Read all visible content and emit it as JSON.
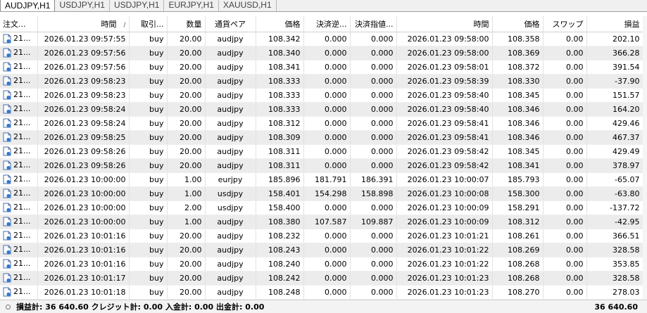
{
  "tabs": [
    {
      "label": "AUDJPY,H1",
      "active": true
    },
    {
      "label": "USDJPY,H1",
      "active": false
    },
    {
      "label": "USDJPY,H1",
      "active": false
    },
    {
      "label": "EURJPY,H1",
      "active": false
    },
    {
      "label": "XAUUSD,H1",
      "active": false
    }
  ],
  "columns": [
    "注文...",
    "時間",
    "取引...",
    "数量",
    "通貨ペア",
    "価格",
    "決済逆...",
    "決済指値...",
    "時間",
    "価格",
    "スワップ",
    "損益"
  ],
  "sort_mark": "/",
  "icon": "order-ticket-icon",
  "rows": [
    [
      "21...",
      "2026.01.23 09:57:55",
      "buy",
      "20.00",
      "audjpy",
      "108.342",
      "0.000",
      "0.000",
      "2026.01.23 09:58:00",
      "108.358",
      "0.00",
      "202.10"
    ],
    [
      "21...",
      "2026.01.23 09:57:56",
      "buy",
      "20.00",
      "audjpy",
      "108.340",
      "0.000",
      "0.000",
      "2026.01.23 09:58:00",
      "108.369",
      "0.00",
      "366.28"
    ],
    [
      "21...",
      "2026.01.23 09:57:56",
      "buy",
      "20.00",
      "audjpy",
      "108.341",
      "0.000",
      "0.000",
      "2026.01.23 09:58:01",
      "108.372",
      "0.00",
      "391.54"
    ],
    [
      "21...",
      "2026.01.23 09:58:23",
      "buy",
      "20.00",
      "audjpy",
      "108.333",
      "0.000",
      "0.000",
      "2026.01.23 09:58:39",
      "108.330",
      "0.00",
      "-37.90"
    ],
    [
      "21...",
      "2026.01.23 09:58:23",
      "buy",
      "20.00",
      "audjpy",
      "108.333",
      "0.000",
      "0.000",
      "2026.01.23 09:58:40",
      "108.345",
      "0.00",
      "151.57"
    ],
    [
      "21...",
      "2026.01.23 09:58:24",
      "buy",
      "20.00",
      "audjpy",
      "108.333",
      "0.000",
      "0.000",
      "2026.01.23 09:58:40",
      "108.346",
      "0.00",
      "164.20"
    ],
    [
      "21...",
      "2026.01.23 09:58:24",
      "buy",
      "20.00",
      "audjpy",
      "108.312",
      "0.000",
      "0.000",
      "2026.01.23 09:58:41",
      "108.346",
      "0.00",
      "429.46"
    ],
    [
      "21...",
      "2026.01.23 09:58:25",
      "buy",
      "20.00",
      "audjpy",
      "108.309",
      "0.000",
      "0.000",
      "2026.01.23 09:58:41",
      "108.346",
      "0.00",
      "467.37"
    ],
    [
      "21...",
      "2026.01.23 09:58:26",
      "buy",
      "20.00",
      "audjpy",
      "108.311",
      "0.000",
      "0.000",
      "2026.01.23 09:58:42",
      "108.345",
      "0.00",
      "429.49"
    ],
    [
      "21...",
      "2026.01.23 09:58:26",
      "buy",
      "20.00",
      "audjpy",
      "108.311",
      "0.000",
      "0.000",
      "2026.01.23 09:58:42",
      "108.341",
      "0.00",
      "378.97"
    ],
    [
      "21...",
      "2026.01.23 10:00:00",
      "buy",
      "1.00",
      "eurjpy",
      "185.896",
      "181.791",
      "186.391",
      "2026.01.23 10:00:07",
      "185.793",
      "0.00",
      "-65.07"
    ],
    [
      "21...",
      "2026.01.23 10:00:00",
      "buy",
      "1.00",
      "usdjpy",
      "158.401",
      "154.298",
      "158.898",
      "2026.01.23 10:00:08",
      "158.300",
      "0.00",
      "-63.80"
    ],
    [
      "21...",
      "2026.01.23 10:00:00",
      "buy",
      "2.00",
      "usdjpy",
      "158.400",
      "0.000",
      "0.000",
      "2026.01.23 10:00:09",
      "158.291",
      "0.00",
      "-137.72"
    ],
    [
      "21...",
      "2026.01.23 10:00:00",
      "buy",
      "1.00",
      "audjpy",
      "108.380",
      "107.587",
      "109.887",
      "2026.01.23 10:00:09",
      "108.312",
      "0.00",
      "-42.95"
    ],
    [
      "21...",
      "2026.01.23 10:01:16",
      "buy",
      "20.00",
      "audjpy",
      "108.232",
      "0.000",
      "0.000",
      "2026.01.23 10:01:21",
      "108.261",
      "0.00",
      "366.51"
    ],
    [
      "21...",
      "2026.01.23 10:01:16",
      "buy",
      "20.00",
      "audjpy",
      "108.243",
      "0.000",
      "0.000",
      "2026.01.23 10:01:22",
      "108.269",
      "0.00",
      "328.58"
    ],
    [
      "21...",
      "2026.01.23 10:01:16",
      "buy",
      "20.00",
      "audjpy",
      "108.240",
      "0.000",
      "0.000",
      "2026.01.23 10:01:22",
      "108.268",
      "0.00",
      "353.85"
    ],
    [
      "21...",
      "2026.01.23 10:01:17",
      "buy",
      "20.00",
      "audjpy",
      "108.242",
      "0.000",
      "0.000",
      "2026.01.23 10:01:23",
      "108.268",
      "0.00",
      "328.58"
    ],
    [
      "21...",
      "2026.01.23 10:01:18",
      "buy",
      "20.00",
      "audjpy",
      "108.248",
      "0.000",
      "0.000",
      "2026.01.23 10:01:23",
      "108.270",
      "0.00",
      "278.03"
    ]
  ],
  "status": {
    "summary": "損益計: 36 640.60  クレジット計: 0.00  入金計: 0.00  出金計: 0.00",
    "total": "36 640.60"
  }
}
